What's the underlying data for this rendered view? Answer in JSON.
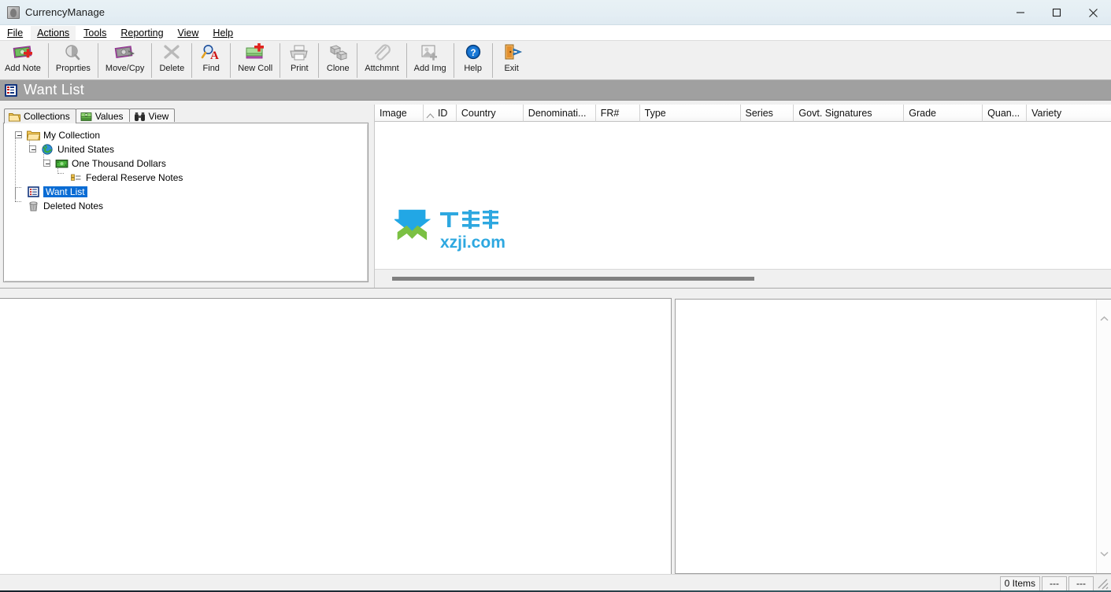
{
  "window": {
    "title": "CurrencyManage",
    "icon": "banknote-portrait-icon",
    "controls": [
      {
        "name": "minimize-button",
        "glyph": "minimize-icon"
      },
      {
        "name": "maximize-button",
        "glyph": "maximize-icon"
      },
      {
        "name": "close-button",
        "glyph": "close-icon"
      }
    ]
  },
  "menubar": {
    "items": [
      {
        "label": "File",
        "mnemonic": "F"
      },
      {
        "label": "Actions",
        "mnemonic": "A"
      },
      {
        "label": "Tools",
        "mnemonic": "T"
      },
      {
        "label": "Reporting",
        "mnemonic": "R"
      },
      {
        "label": "View",
        "mnemonic": "V"
      },
      {
        "label": "Help",
        "mnemonic": "H"
      }
    ]
  },
  "toolbar": {
    "buttons": [
      {
        "label": "Add Note",
        "icon": "add-note-icon",
        "enabled": true
      },
      {
        "label": "Proprties",
        "icon": "properties-icon",
        "enabled": false
      },
      {
        "label": "Move/Cpy",
        "icon": "move-copy-icon",
        "enabled": true
      },
      {
        "label": "Delete",
        "icon": "delete-x-icon",
        "enabled": false
      },
      {
        "label": "Find",
        "icon": "find-icon",
        "enabled": true
      },
      {
        "label": "New Coll",
        "icon": "new-collection-icon",
        "enabled": true
      },
      {
        "label": "Print",
        "icon": "print-icon",
        "enabled": false
      },
      {
        "label": "Clone",
        "icon": "clone-icon",
        "enabled": false
      },
      {
        "label": "Attchmnt",
        "icon": "attachment-paperclip-icon",
        "enabled": false
      },
      {
        "label": "Add Img",
        "icon": "add-image-icon",
        "enabled": false
      },
      {
        "label": "Help",
        "icon": "help-question-icon",
        "enabled": true
      },
      {
        "label": "Exit",
        "icon": "exit-door-icon",
        "enabled": true
      }
    ],
    "separators_after": [
      1,
      2,
      3,
      4,
      5,
      6,
      7,
      8,
      9,
      10
    ]
  },
  "banner": {
    "icon": "list-view-icon",
    "title": "Want List"
  },
  "left_pane": {
    "tabs": [
      {
        "label": "Collections",
        "icon": "folder-icon",
        "active": true
      },
      {
        "label": "Values",
        "icon": "money-stack-icon",
        "active": false
      },
      {
        "label": "View",
        "icon": "binoculars-icon",
        "active": false
      }
    ],
    "tree": [
      {
        "label": "My Collection",
        "depth": 0,
        "icon": "folder-open-icon",
        "expander": "minus",
        "selected": false
      },
      {
        "label": "United States",
        "depth": 1,
        "icon": "globe-icon",
        "expander": "minus",
        "selected": false
      },
      {
        "label": "One Thousand Dollars",
        "depth": 2,
        "icon": "banknote-icon",
        "expander": "minus",
        "selected": false
      },
      {
        "label": "Federal Reserve Notes",
        "depth": 3,
        "icon": "note-type-icon",
        "expander": "none",
        "selected": false
      },
      {
        "label": "Want List",
        "depth": 0,
        "icon": "list-view-icon",
        "expander": "none",
        "selected": true
      },
      {
        "label": "Deleted Notes",
        "depth": 0,
        "icon": "trash-can-icon",
        "expander": "none",
        "selected": false
      }
    ]
  },
  "listview": {
    "columns": [
      {
        "label": "Image",
        "width": 62,
        "sorted": false
      },
      {
        "label": "ID",
        "width": 42,
        "sorted": true
      },
      {
        "label": "Country",
        "width": 85,
        "sorted": false
      },
      {
        "label": "Denominati...",
        "width": 92,
        "sorted": false
      },
      {
        "label": "FR#",
        "width": 56,
        "sorted": false
      },
      {
        "label": "Type",
        "width": 128,
        "sorted": false
      },
      {
        "label": "Series",
        "width": 68,
        "sorted": false
      },
      {
        "label": "Govt. Signatures",
        "width": 140,
        "sorted": false
      },
      {
        "label": "Grade",
        "width": 100,
        "sorted": false
      },
      {
        "label": "Quan...",
        "width": 56,
        "sorted": false
      },
      {
        "label": "Variety",
        "width": 107,
        "sorted": false
      }
    ],
    "rows": [],
    "watermark": {
      "cn_text": "下载集",
      "domain_text": "xzji.com",
      "arrow_color": "#1ea2e0",
      "chevron_color": "#7ac142",
      "domain_color": "#1ea2e0"
    }
  },
  "statusbar": {
    "cells": [
      {
        "label": "0 Items",
        "name": "item-count"
      },
      {
        "label": "---",
        "name": "status-field-2"
      },
      {
        "label": "---",
        "name": "status-field-3"
      }
    ],
    "grip": "resize-grip-icon"
  },
  "colors": {
    "banner_bg": "#a0a0a0",
    "selection_blue": "#0a6cd4",
    "chrome_bg": "#f0f0f0",
    "titlebar_bg": "#e4eef4"
  }
}
